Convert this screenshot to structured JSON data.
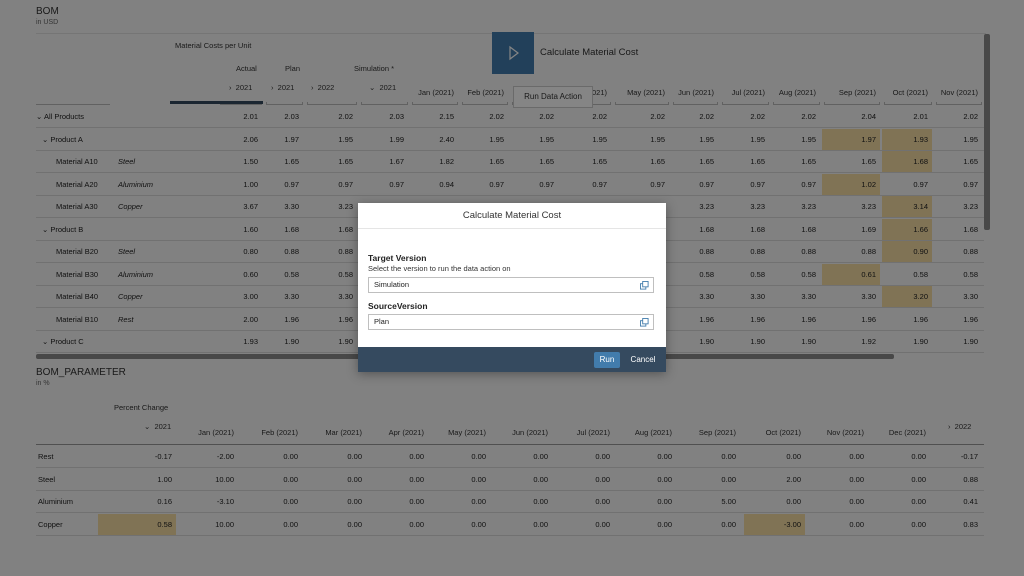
{
  "bom": {
    "title": "BOM",
    "subtitle": "in USD",
    "col_group": "Material Costs per Unit",
    "versions": [
      "Actual",
      "Plan",
      "",
      "Simulation *"
    ],
    "years": [
      "2021",
      "2021",
      "2022",
      "2021"
    ],
    "months": [
      "Jan (2021)",
      "Feb (2021)",
      "Mar (2021)",
      "Apr (2021)",
      "May (2021)",
      "Jun (2021)",
      "Jul (2021)",
      "Aug (2021)",
      "Sep (2021)",
      "Oct (2021)",
      "Nov (2021)"
    ],
    "rows": [
      {
        "label": "All Products",
        "type": "",
        "vals": [
          "2.01",
          "2.03",
          "2.02",
          "2.03",
          "2.15",
          "2.02",
          "2.02",
          "2.02",
          "2.02",
          "2.02",
          "2.02",
          "2.02",
          "2.04",
          "2.01",
          "2.02"
        ]
      },
      {
        "label": "Product A",
        "type": "",
        "vals": [
          "2.06",
          "1.97",
          "1.95",
          "1.99",
          "2.40",
          "1.95",
          "1.95",
          "1.95",
          "1.95",
          "1.95",
          "1.95",
          "1.95",
          "1.97",
          "1.93",
          "1.95"
        ]
      },
      {
        "label": "Material A10",
        "type": "Steel",
        "vals": [
          "1.50",
          "1.65",
          "1.65",
          "1.67",
          "1.82",
          "1.65",
          "1.65",
          "1.65",
          "1.65",
          "1.65",
          "1.65",
          "1.65",
          "1.65",
          "1.68",
          "1.65"
        ]
      },
      {
        "label": "Material A20",
        "type": "Aluminium",
        "vals": [
          "1.00",
          "0.97",
          "0.97",
          "0.97",
          "0.94",
          "0.97",
          "0.97",
          "0.97",
          "0.97",
          "0.97",
          "0.97",
          "0.97",
          "1.02",
          "0.97",
          "0.97"
        ]
      },
      {
        "label": "Material A30",
        "type": "Copper",
        "vals": [
          "3.67",
          "3.30",
          "3.23",
          "",
          "",
          "",
          "",
          "",
          "",
          "3.23",
          "3.23",
          "3.23",
          "3.23",
          "3.14",
          "3.23"
        ]
      },
      {
        "label": "Product B",
        "type": "",
        "vals": [
          "1.60",
          "1.68",
          "1.68",
          "",
          "",
          "",
          "",
          "",
          "",
          "1.68",
          "1.68",
          "1.68",
          "1.69",
          "1.66",
          "1.68"
        ]
      },
      {
        "label": "Material B20",
        "type": "Steel",
        "vals": [
          "0.80",
          "0.88",
          "0.88",
          "",
          "",
          "",
          "",
          "",
          "",
          "0.88",
          "0.88",
          "0.88",
          "0.88",
          "0.90",
          "0.88"
        ]
      },
      {
        "label": "Material B30",
        "type": "Aluminium",
        "vals": [
          "0.60",
          "0.58",
          "0.58",
          "",
          "",
          "",
          "",
          "",
          "",
          "0.58",
          "0.58",
          "0.58",
          "0.61",
          "0.58",
          "0.58"
        ]
      },
      {
        "label": "Material B40",
        "type": "Copper",
        "vals": [
          "3.00",
          "3.30",
          "3.30",
          "",
          "",
          "",
          "",
          "",
          "",
          "3.30",
          "3.30",
          "3.30",
          "3.30",
          "3.20",
          "3.30"
        ]
      },
      {
        "label": "Material B10",
        "type": "Rest",
        "vals": [
          "2.00",
          "1.96",
          "1.96",
          "",
          "",
          "",
          "",
          "",
          "",
          "1.96",
          "1.96",
          "1.96",
          "1.96",
          "1.96",
          "1.96"
        ]
      },
      {
        "label": "Product C",
        "type": "",
        "vals": [
          "1.93",
          "1.90",
          "1.90",
          "",
          "",
          "",
          "",
          "",
          "",
          "1.90",
          "1.90",
          "1.90",
          "1.92",
          "1.90",
          "1.90"
        ]
      }
    ]
  },
  "action_bar": {
    "button_label": "Calculate Material Cost",
    "tooltip": "Run Data Action"
  },
  "param": {
    "title": "BOM_PARAMETER",
    "subtitle": "in %",
    "col_group": "Percent Change",
    "year_first": "2021",
    "months": [
      "Jan (2021)",
      "Feb (2021)",
      "Mar (2021)",
      "Apr (2021)",
      "May (2021)",
      "Jun (2021)",
      "Jul (2021)",
      "Aug (2021)",
      "Sep (2021)",
      "Oct (2021)",
      "Nov (2021)",
      "Dec (2021)"
    ],
    "year_last": "2022",
    "rows": [
      {
        "label": "Rest",
        "vals": [
          "-0.17",
          "-2.00",
          "0.00",
          "0.00",
          "0.00",
          "0.00",
          "0.00",
          "0.00",
          "0.00",
          "0.00",
          "0.00",
          "0.00",
          "0.00",
          "-0.17"
        ]
      },
      {
        "label": "Steel",
        "vals": [
          "1.00",
          "10.00",
          "0.00",
          "0.00",
          "0.00",
          "0.00",
          "0.00",
          "0.00",
          "0.00",
          "0.00",
          "2.00",
          "0.00",
          "0.00",
          "0.88"
        ]
      },
      {
        "label": "Aluminium",
        "vals": [
          "0.16",
          "-3.10",
          "0.00",
          "0.00",
          "0.00",
          "0.00",
          "0.00",
          "0.00",
          "0.00",
          "5.00",
          "0.00",
          "0.00",
          "0.00",
          "0.41"
        ]
      },
      {
        "label": "Copper",
        "vals": [
          "0.58",
          "10.00",
          "0.00",
          "0.00",
          "0.00",
          "0.00",
          "0.00",
          "0.00",
          "0.00",
          "0.00",
          "-3.00",
          "0.00",
          "0.00",
          "0.83"
        ]
      }
    ]
  },
  "dialog": {
    "title": "Calculate Material Cost",
    "target_label": "Target Version",
    "target_desc": "Select the version to run the data action on",
    "target_value": "Simulation",
    "source_label": "SourceVersion",
    "source_value": "Plan",
    "run_label": "Run",
    "cancel_label": "Cancel"
  },
  "colors": {
    "highlight": "#f5dca4",
    "footer": "#354a5f",
    "run_button": "#427cac",
    "action_button": "#427cac"
  }
}
